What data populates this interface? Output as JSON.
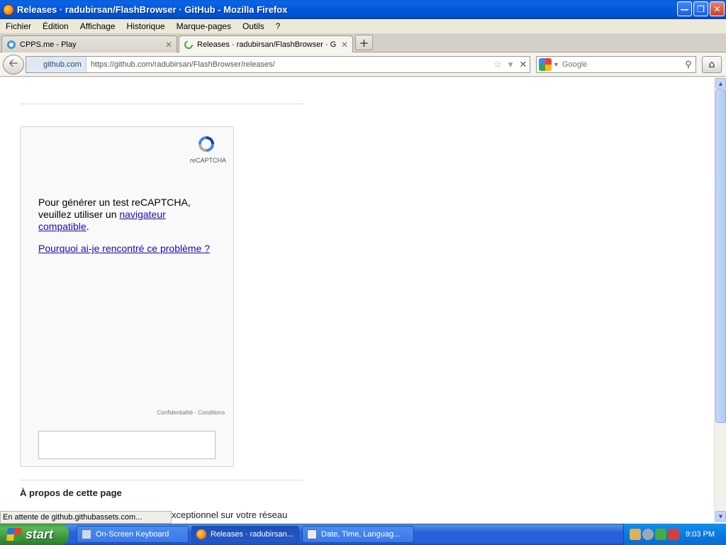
{
  "window": {
    "title": "Releases · radubirsan/FlashBrowser · GitHub - Mozilla Firefox"
  },
  "menu": [
    "Fichier",
    "Édition",
    "Affichage",
    "Historique",
    "Marque-pages",
    "Outils",
    "?"
  ],
  "tabs": [
    {
      "label": "CPPS.me - Play",
      "active": false
    },
    {
      "label": "Releases · radubirsan/FlashBrowser · Git...",
      "active": true
    }
  ],
  "nav": {
    "identity": "github.com",
    "url": "https://github.com/radubirsan/FlashBrowser/releases/",
    "search_placeholder": "Google"
  },
  "recaptcha": {
    "caption": "reCAPTCHA",
    "message_prefix": "Pour générer un test reCAPTCHA, veuillez utiliser un",
    "message_link": "navigateur compatible",
    "message_suffix": ".",
    "why_link": "Pourquoi ai-je rencontré ce problème ?",
    "legal": "Confidentialité - Conditions"
  },
  "page": {
    "about_heading": "À propos de cette page",
    "snippet": "xceptionnel sur votre réseau"
  },
  "status": "En attente de github.githubassets.com...",
  "taskbar": {
    "start": "start",
    "items": [
      {
        "label": "On-Screen Keyboard"
      },
      {
        "label": "Releases · radubirsan..."
      },
      {
        "label": "Date, Time, Languag..."
      }
    ],
    "clock": "9:03 PM"
  },
  "colors": {
    "link": "#1a0dab",
    "xp_blue": "#245edb",
    "start_green": "#3a913a"
  }
}
